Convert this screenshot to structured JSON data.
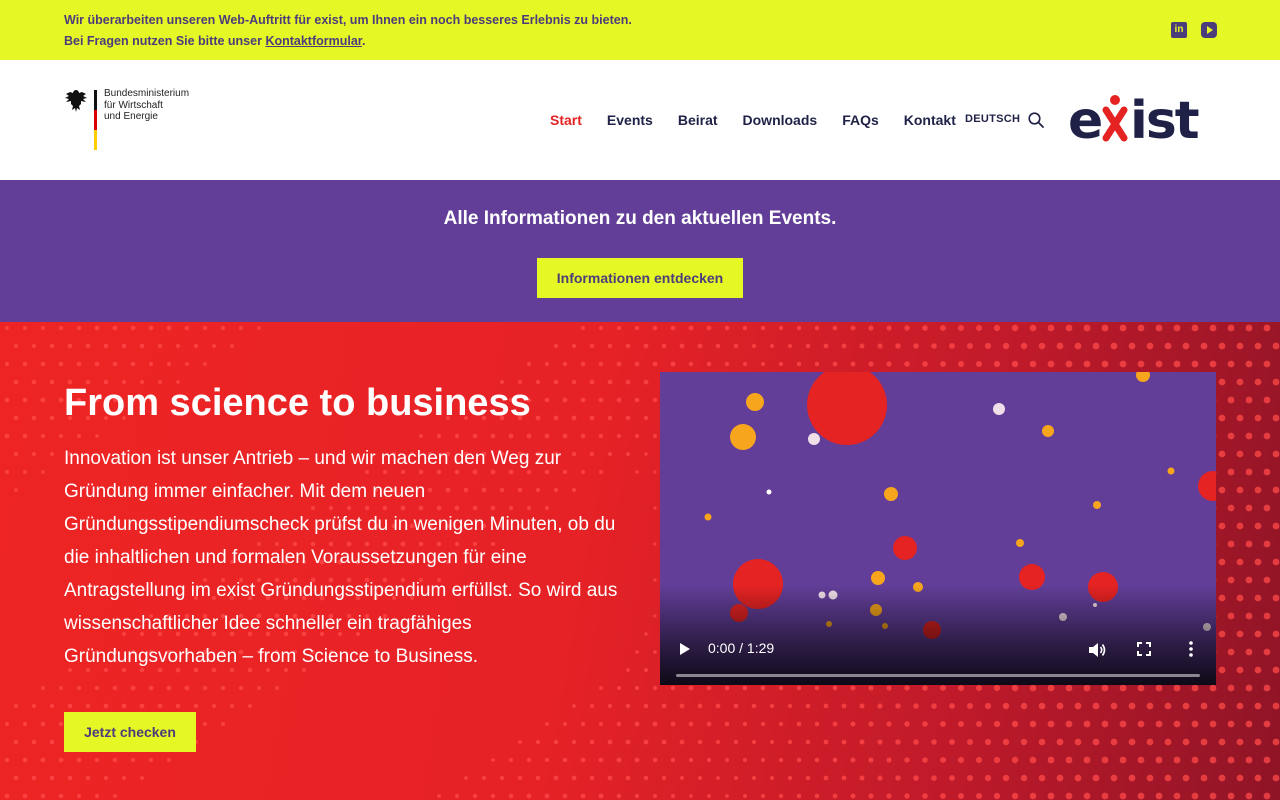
{
  "notice": {
    "line1": "Wir überarbeiten unseren Web-Auftritt für exist, um Ihnen ein noch besseres Erlebnis zu bieten.",
    "line2_prefix": "Bei Fragen nutzen Sie bitte unser ",
    "line2_link": "Kontaktformular",
    "line2_suffix": ".",
    "social": [
      {
        "name": "linkedin-icon",
        "glyph": "in"
      },
      {
        "name": "youtube-icon"
      }
    ]
  },
  "header": {
    "ministry": [
      "Bundesministerium",
      "für Wirtschaft",
      "und Energie"
    ],
    "nav": [
      "Start",
      "Events",
      "Beirat",
      "Downloads",
      "FAQs",
      "Kontakt"
    ],
    "active_nav": "Start",
    "language": "DEUTSCH",
    "logo_text": "exist",
    "colors": {
      "accent": "#e52323",
      "navy": "#1f2147"
    }
  },
  "band": {
    "title": "Alle Informationen zu den aktuellen Events.",
    "button": "Informationen entdecken",
    "colors": {
      "background": "#623e98",
      "button": "#e6f726"
    }
  },
  "hero": {
    "title": "From science to business",
    "text": "Innovation ist unser Antrieb – und wir machen den Weg zur Gründung immer einfacher. Mit dem neuen Gründungsstipendiumscheck prüfst du in wenigen Minuten, ob du die inhaltlichen und formalen Voraussetzungen für eine Antragstellung im exist Gründungsstipendium erfüllst. So wird aus wissenschaftlicher Idee schneller ein tragfähiges Gründungsvorhaben – from Science to Business.",
    "button": "Jetzt checken",
    "colors": {
      "background": "#e62226"
    }
  },
  "video": {
    "time": "0:00 / 1:29",
    "progress": 0
  }
}
